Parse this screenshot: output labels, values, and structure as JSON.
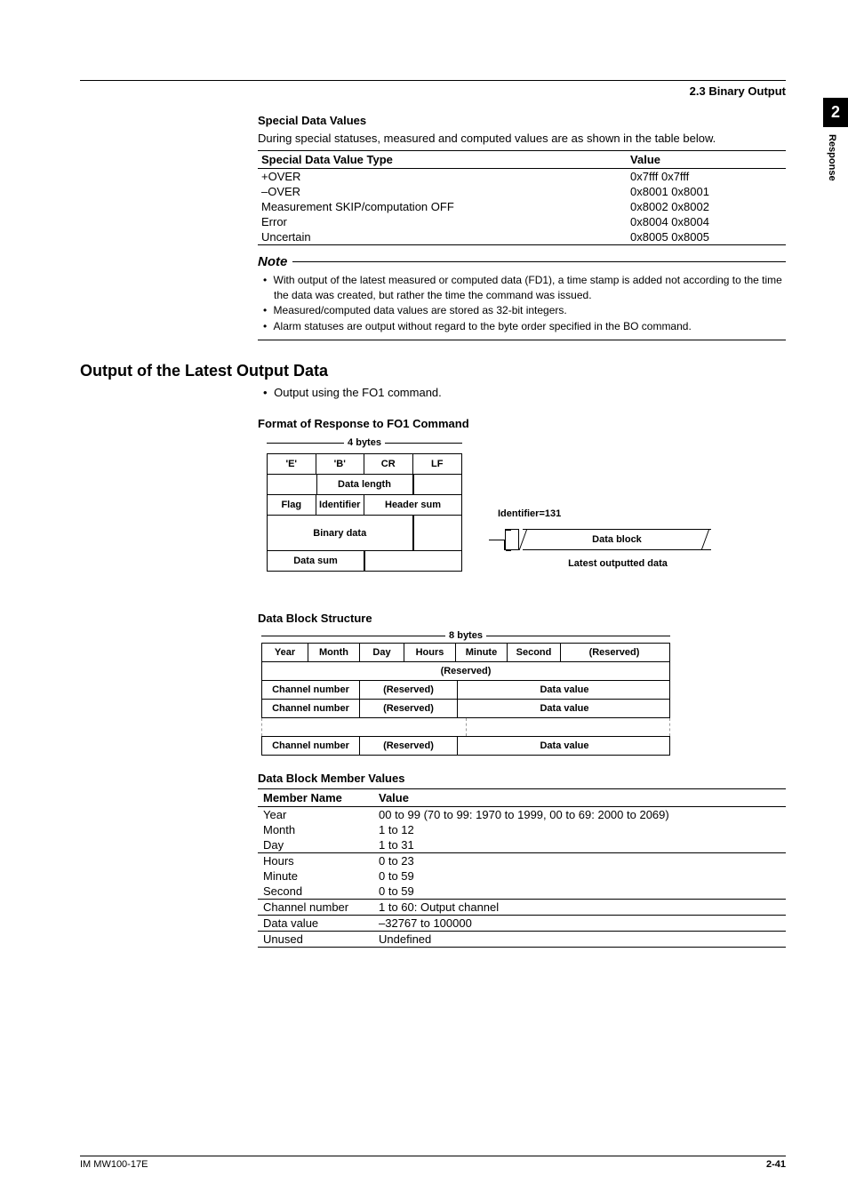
{
  "header": {
    "section": "2.3 Binary Output"
  },
  "tab": {
    "number": "2",
    "label": "Response"
  },
  "special": {
    "heading": "Special Data Values",
    "intro": "During special statuses, measured and computed values are as shown in the table below.",
    "col1": "Special Data Value Type",
    "col2": "Value",
    "rows": [
      {
        "t": "+OVER",
        "v": "0x7fff 0x7fff"
      },
      {
        "t": "–OVER",
        "v": "0x8001 0x8001"
      },
      {
        "t": "Measurement SKIP/computation OFF",
        "v": "0x8002 0x8002"
      },
      {
        "t": "Error",
        "v": "0x8004 0x8004"
      },
      {
        "t": "Uncertain",
        "v": "0x8005 0x8005"
      }
    ]
  },
  "note": {
    "heading": "Note",
    "items": [
      "With output of the latest measured or computed data (FD1), a time stamp is added not according to the time the data was created, but rather the time the command was issued.",
      "Measured/computed data values are stored as 32-bit integers.",
      "Alarm statuses are output without regard to the byte order specified in the BO command."
    ]
  },
  "output": {
    "title": "Output of the Latest Output Data",
    "bullet": "Output using the FO1 command.",
    "format_heading": "Format of Response to FO1 Command",
    "fo1": {
      "bytes_label": "4 bytes",
      "r1": {
        "a": "'E'",
        "b": "'B'",
        "c": "CR",
        "d": "LF"
      },
      "r2": "Data length",
      "r3": {
        "a": "Flag",
        "b": "Identifier",
        "c": "Header sum"
      },
      "r4": "Binary data",
      "r5": "Data sum",
      "identifier": "Identifier=131",
      "data_block": "Data block",
      "latest": "Latest outputted data"
    },
    "dbs_heading": "Data Block Structure",
    "dbs": {
      "bytes8": "8 bytes",
      "r1": {
        "a": "Year",
        "b": "Month",
        "c": "Day",
        "d": "Hours",
        "e": "Minute",
        "f": "Second",
        "g": "(Reserved)"
      },
      "r2": "(Reserved)",
      "rn": {
        "a": "Channel number",
        "b": "(Reserved)",
        "c": "Data value"
      }
    },
    "members_heading": "Data Block Member Values",
    "members": {
      "col1": "Member Name",
      "col2": "Value",
      "rows": [
        {
          "n": "Year",
          "v": "00 to 99  (70 to 99: 1970 to 1999, 00 to 69: 2000 to 2069)",
          "grp": false
        },
        {
          "n": "Month",
          "v": "1 to 12",
          "grp": false
        },
        {
          "n": "Day",
          "v": "1 to 31",
          "grp": true
        },
        {
          "n": "Hours",
          "v": "0 to 23",
          "grp": false
        },
        {
          "n": "Minute",
          "v": "0 to 59",
          "grp": false
        },
        {
          "n": "Second",
          "v": "0 to 59",
          "grp": true
        },
        {
          "n": "Channel number",
          "v": "1 to 60: Output channel",
          "grp": true
        },
        {
          "n": "Data value",
          "v": "–32767 to 100000",
          "grp": true
        },
        {
          "n": "Unused",
          "v": "Undefined",
          "grp": true
        }
      ]
    }
  },
  "footer": {
    "left": "IM MW100-17E",
    "right": "2-41"
  }
}
